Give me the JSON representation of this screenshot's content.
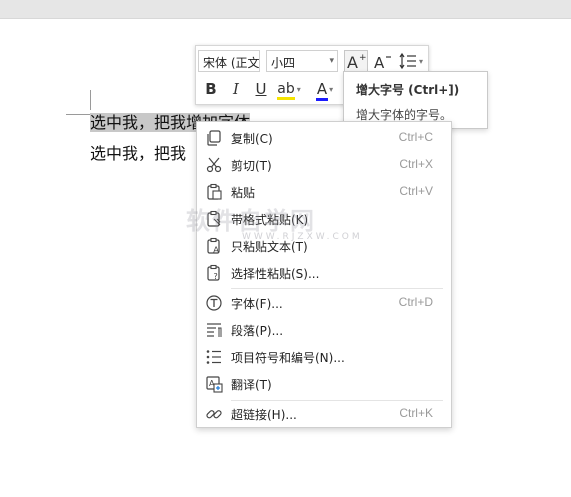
{
  "document": {
    "line1_selected": "选中我，把我增加字体",
    "line2": "选中我，把我"
  },
  "toolbar": {
    "font_name": "宋体 (正文",
    "font_size": "小四",
    "grow_font_icon": "font-size-increase-icon",
    "shrink_font_icon": "font-size-decrease-icon",
    "line_spacing_icon": "line-spacing-icon",
    "bold": "B",
    "italic": "I",
    "underline": "U",
    "highlight": "ab",
    "font_color": "A",
    "highlight_color": "#f5e400",
    "font_color_value": "#1a1aff"
  },
  "tooltip": {
    "title": "增大字号 (Ctrl+])",
    "description": "增大字体的字号。"
  },
  "context_menu": {
    "items": [
      {
        "label": "复制(C)",
        "shortcut": "Ctrl+C",
        "icon": "copy-icon"
      },
      {
        "label": "剪切(T)",
        "shortcut": "Ctrl+X",
        "icon": "cut-icon"
      },
      {
        "label": "粘贴",
        "shortcut": "Ctrl+V",
        "icon": "paste-icon"
      },
      {
        "label": "带格式粘贴(K)",
        "shortcut": "",
        "icon": "paste-formatted-icon"
      },
      {
        "label": "只粘贴文本(T)",
        "shortcut": "",
        "icon": "paste-text-icon"
      },
      {
        "label": "选择性粘贴(S)...",
        "shortcut": "",
        "icon": "paste-special-icon"
      },
      {
        "label": "字体(F)...",
        "shortcut": "Ctrl+D",
        "icon": "font-icon"
      },
      {
        "label": "段落(P)...",
        "shortcut": "",
        "icon": "paragraph-icon"
      },
      {
        "label": "项目符号和编号(N)...",
        "shortcut": "",
        "icon": "bullets-numbering-icon"
      },
      {
        "label": "翻译(T)",
        "shortcut": "",
        "icon": "translate-icon"
      },
      {
        "label": "超链接(H)...",
        "shortcut": "Ctrl+K",
        "icon": "hyperlink-icon"
      }
    ]
  },
  "watermark": {
    "text": "软件自学网",
    "sub": "WWW.RJZXW.COM"
  }
}
